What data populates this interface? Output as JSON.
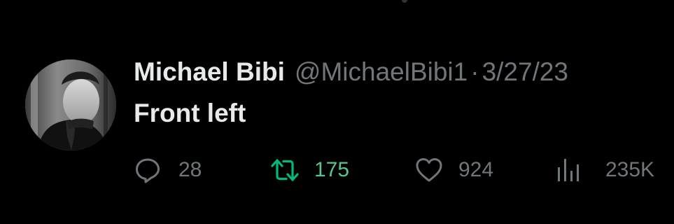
{
  "tweet": {
    "display_name": "Michael Bibi",
    "handle": "@MichaelBibi1",
    "separator": "·",
    "date": "3/27/23",
    "text": "Front left",
    "avatar_icon": "profile-photo",
    "actions": {
      "reply": {
        "icon": "reply-icon",
        "count": "28"
      },
      "retweet": {
        "icon": "retweet-icon",
        "count": "175",
        "active": true,
        "color": "#00ba7c"
      },
      "like": {
        "icon": "heart-icon",
        "count": "924"
      },
      "views": {
        "icon": "analytics-icon",
        "count": "235K"
      }
    }
  },
  "colors": {
    "background": "#000000",
    "primary_text": "#e7e9ea",
    "secondary_text": "#71767b",
    "retweet_green": "#00ba7c"
  }
}
